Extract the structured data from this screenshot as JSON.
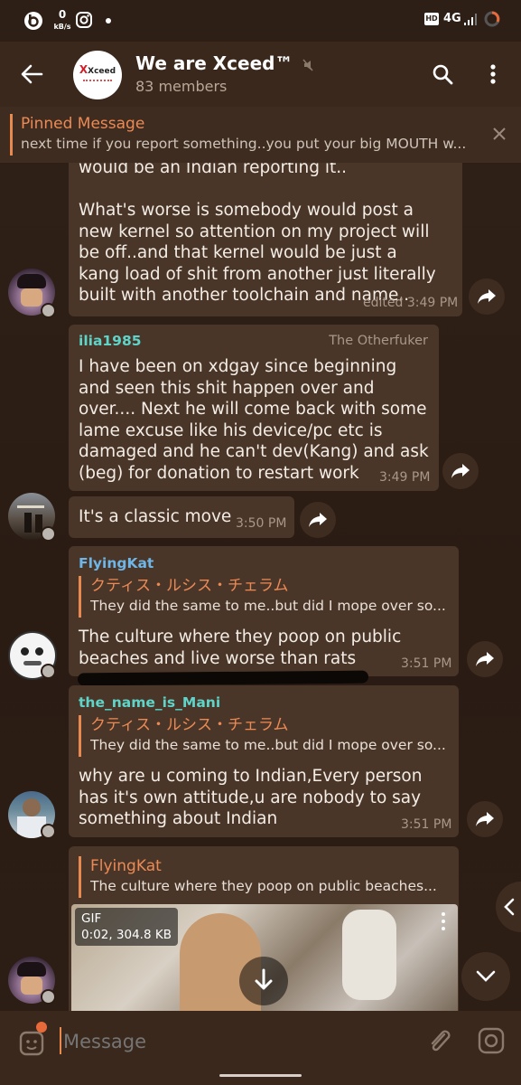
{
  "status_bar": {
    "netspeed_value": "0",
    "netspeed_unit": "kB/s",
    "hd_badge": "HD",
    "network": "4G"
  },
  "header": {
    "logo_text": "Xceed",
    "title": "We are Xceed™",
    "subtitle": "83 members"
  },
  "pinned": {
    "label": "Pinned Message",
    "text": "next time if you report something..you put your big MOUTH w..."
  },
  "messages": [
    {
      "text": "would be an Indian reporting it..\n\nWhat's worse is somebody would post a new kernel so attention on my project will be off..and that kernel would be just a kang load of shit from another just literally built with another toolchain and name..",
      "time": "edited 3:49 PM"
    },
    {
      "sender": "ilia1985",
      "admin_title": "The Otherfuker",
      "text": "I have been on xdgay since beginning and seen this shit happen over and over.... Next he will come back with some lame excuse like his device/pc etc is damaged and he can't dev(Kang) and ask (beg) for donation to restart work",
      "time": "3:49 PM"
    },
    {
      "text": "It's a classic move",
      "time": "3:50 PM"
    },
    {
      "sender": "FlyingKat",
      "reply_name": "クティス・ルシス・チェラム",
      "reply_text": "They did the same to me..but did I mope over so...",
      "text": "The culture where they poop on public beaches and live worse than rats",
      "time": "3:51 PM"
    },
    {
      "sender": "the_name_is_Mani",
      "reply_name": "クティス・ルシス・チェラム",
      "reply_text": "They did the same to me..but did I mope over so...",
      "text": "why are u coming to Indian,Every person has it's own attitude,u are nobody to say something about Indian",
      "time": "3:51 PM"
    },
    {
      "reply_name": "FlyingKat",
      "reply_text": "The culture where they poop on public beaches...",
      "gif_label": "GIF",
      "gif_info": "0:02, 304.8 KB"
    }
  ],
  "input": {
    "placeholder": "Message"
  },
  "colors": {
    "header_bg": "#3a281c",
    "chat_bg": "#2a1c13",
    "bubble_bg": "#4a3628",
    "accent": "#e88a50",
    "sender_ilia": "#5fd4c9",
    "sender_flyingkat": "#6fb6e8",
    "sender_mani": "#5fd4c9"
  }
}
